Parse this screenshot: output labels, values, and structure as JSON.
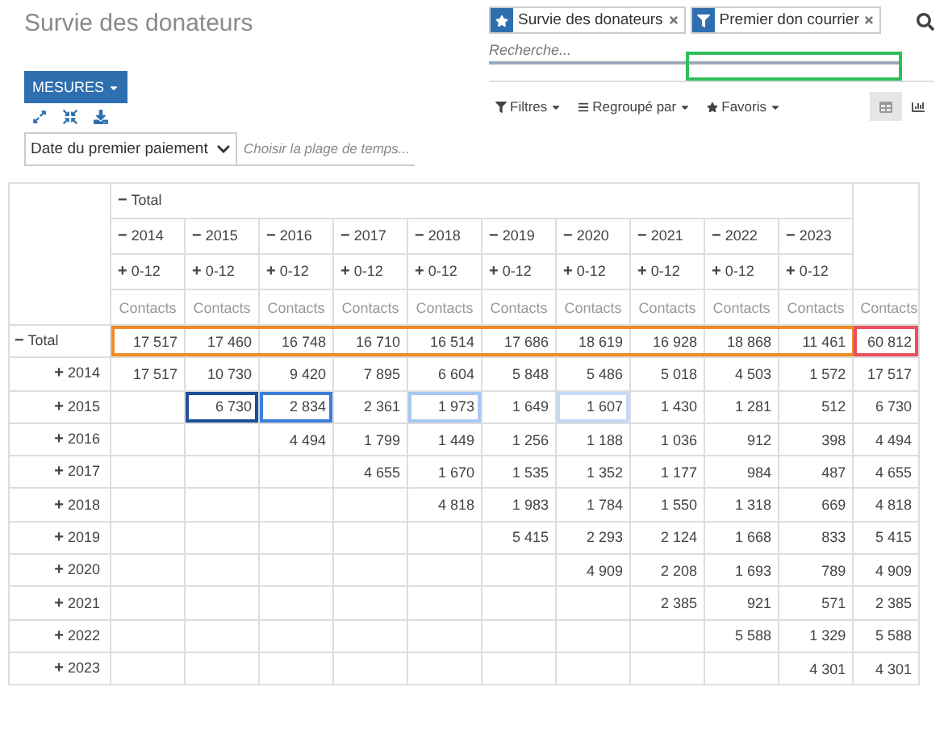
{
  "title": "Survie des donateurs",
  "facets": [
    {
      "kind": "favorite",
      "label": "Survie des donateurs"
    },
    {
      "kind": "filter",
      "label": "Premier don courrier"
    }
  ],
  "search": {
    "placeholder": "Recherche...",
    "highlight": {
      "color": "#2fbf5a"
    }
  },
  "toolbar": {
    "menus": [
      {
        "kind": "filter",
        "label": "Filtres"
      },
      {
        "kind": "groupby",
        "label": "Regroupé par"
      },
      {
        "kind": "favorite",
        "label": "Favoris"
      }
    ],
    "views": [
      {
        "kind": "pivot",
        "selected": true
      },
      {
        "kind": "graph",
        "selected": false
      }
    ]
  },
  "measures_button": "MESURES",
  "date_select": {
    "value": "Date du premier paiement"
  },
  "range_field": {
    "placeholder": "Choisir la plage de temps..."
  },
  "pivot": {
    "col_total": {
      "symbol": "−",
      "label": "Total"
    },
    "years": [
      {
        "symbol": "−",
        "label": "2014",
        "sub_symbol": "+",
        "sub_label": "0-12",
        "measure": "Contacts"
      },
      {
        "symbol": "−",
        "label": "2015",
        "sub_symbol": "+",
        "sub_label": "0-12",
        "measure": "Contacts"
      },
      {
        "symbol": "−",
        "label": "2016",
        "sub_symbol": "+",
        "sub_label": "0-12",
        "measure": "Contacts"
      },
      {
        "symbol": "−",
        "label": "2017",
        "sub_symbol": "+",
        "sub_label": "0-12",
        "measure": "Contacts"
      },
      {
        "symbol": "−",
        "label": "2018",
        "sub_symbol": "+",
        "sub_label": "0-12",
        "measure": "Contacts"
      },
      {
        "symbol": "−",
        "label": "2019",
        "sub_symbol": "+",
        "sub_label": "0-12",
        "measure": "Contacts"
      },
      {
        "symbol": "−",
        "label": "2020",
        "sub_symbol": "+",
        "sub_label": "0-12",
        "measure": "Contacts"
      },
      {
        "symbol": "−",
        "label": "2021",
        "sub_symbol": "+",
        "sub_label": "0-12",
        "measure": "Contacts"
      },
      {
        "symbol": "−",
        "label": "2022",
        "sub_symbol": "+",
        "sub_label": "0-12",
        "measure": "Contacts"
      },
      {
        "symbol": "−",
        "label": "2023",
        "sub_symbol": "+",
        "sub_label": "0-12",
        "measure": "Contacts"
      }
    ],
    "total_measure": "Contacts",
    "rows": [
      {
        "symbol": "−",
        "label": "Total",
        "band": {
          "color": "#f08a24"
        },
        "cells": [
          "17 517",
          "17 460",
          "16 748",
          "16 710",
          "16 514",
          "17 686",
          "18 619",
          "16 928",
          "18 868",
          "11 461"
        ],
        "total": {
          "value": "60 812",
          "color": "#e8505b"
        }
      },
      {
        "symbol": "+",
        "label": "2014",
        "cells": [
          "17 517",
          "10 730",
          "9 420",
          "7 895",
          "6 604",
          "5 848",
          "5 486",
          "5 018",
          "4 503",
          "1 572"
        ],
        "total": {
          "value": "17 517"
        }
      },
      {
        "symbol": "+",
        "label": "2015",
        "cells": [
          null,
          {
            "value": "6 730",
            "color": "#1f4e9c"
          },
          {
            "value": "2 834",
            "color": "#3d7fd9"
          },
          "2 361",
          {
            "value": "1 973",
            "color": "#a9c8f2"
          },
          "1 649",
          {
            "value": "1 607",
            "color": "#c5d9f5"
          },
          "1 430",
          "1 281",
          "512"
        ],
        "total": {
          "value": "6 730"
        }
      },
      {
        "symbol": "+",
        "label": "2016",
        "cells": [
          null,
          null,
          "4 494",
          "1 799",
          "1 449",
          "1 256",
          "1 188",
          "1 036",
          "912",
          "398"
        ],
        "total": {
          "value": "4 494"
        }
      },
      {
        "symbol": "+",
        "label": "2017",
        "cells": [
          null,
          null,
          null,
          "4 655",
          "1 670",
          "1 535",
          "1 352",
          "1 177",
          "984",
          "487"
        ],
        "total": {
          "value": "4 655"
        }
      },
      {
        "symbol": "+",
        "label": "2018",
        "cells": [
          null,
          null,
          null,
          null,
          "4 818",
          "1 983",
          "1 784",
          "1 550",
          "1 318",
          "669"
        ],
        "total": {
          "value": "4 818"
        }
      },
      {
        "symbol": "+",
        "label": "2019",
        "cells": [
          null,
          null,
          null,
          null,
          null,
          "5 415",
          "2 293",
          "2 124",
          "1 668",
          "833"
        ],
        "total": {
          "value": "5 415"
        }
      },
      {
        "symbol": "+",
        "label": "2020",
        "cells": [
          null,
          null,
          null,
          null,
          null,
          null,
          "4 909",
          "2 208",
          "1 693",
          "789"
        ],
        "total": {
          "value": "4 909"
        }
      },
      {
        "symbol": "+",
        "label": "2021",
        "cells": [
          null,
          null,
          null,
          null,
          null,
          null,
          null,
          "2 385",
          "921",
          "571"
        ],
        "total": {
          "value": "2 385"
        }
      },
      {
        "symbol": "+",
        "label": "2022",
        "cells": [
          null,
          null,
          null,
          null,
          null,
          null,
          null,
          null,
          "5 588",
          "1 329"
        ],
        "total": {
          "value": "5 588"
        }
      },
      {
        "symbol": "+",
        "label": "2023",
        "cells": [
          null,
          null,
          null,
          null,
          null,
          null,
          null,
          null,
          null,
          "4 301"
        ],
        "total": {
          "value": "4 301"
        }
      }
    ]
  }
}
